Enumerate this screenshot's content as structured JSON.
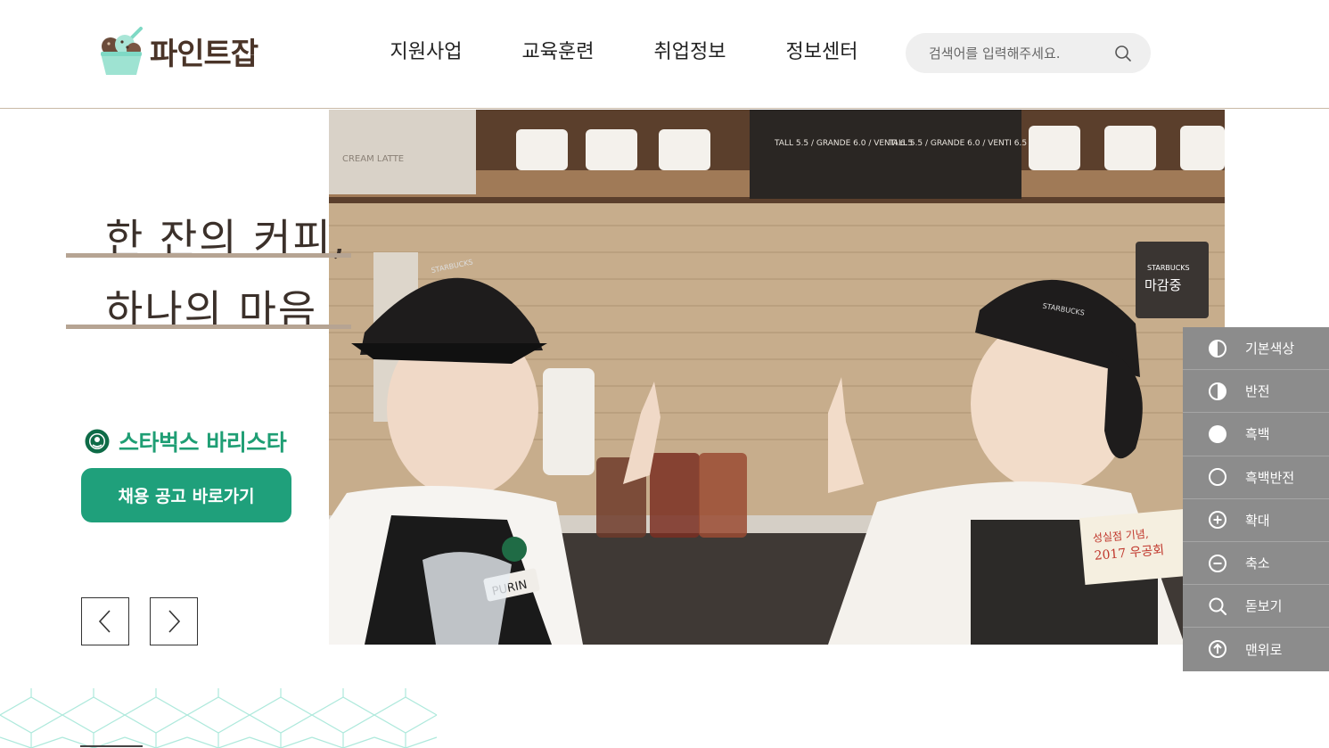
{
  "site": {
    "logo_text": "파인트잡"
  },
  "nav": {
    "items": [
      {
        "label": "지원사업"
      },
      {
        "label": "교육훈련"
      },
      {
        "label": "취업정보"
      },
      {
        "label": "정보센터"
      }
    ]
  },
  "search": {
    "placeholder": "검색어를 입력해주세요.",
    "icon": "search-icon"
  },
  "hero": {
    "slogan_line1": "한 잔의 커피,",
    "slogan_line2": "하나의 마음",
    "brand_name": "스타벅스 바리스타",
    "cta_label": "채용 공고 바로가기",
    "prev_icon": "chevron-left-icon",
    "next_icon": "chevron-right-icon"
  },
  "photo": {
    "board_text_left": "TALL 5.5 / GRANDE 6.0 / VENTI 6.5",
    "board_text_right": "TALL 5.5 / GRANDE 6.0 / VENTI 6.5",
    "closed_sign_brand": "STARBUCKS",
    "closed_sign": "마감중",
    "note_line1": "성실점 기념,",
    "note_line2": "2017 우공회",
    "name_tag": "PURIN",
    "cap_text": "STARBUCKS",
    "menu_corner": "CREAM LATTE"
  },
  "accessibility": {
    "items": [
      {
        "label": "기본색상",
        "icon": "half-circle-icon"
      },
      {
        "label": "반전",
        "icon": "contrast-icon"
      },
      {
        "label": "흑백",
        "icon": "filled-circle-icon"
      },
      {
        "label": "흑백반전",
        "icon": "empty-circle-icon"
      },
      {
        "label": "확대",
        "icon": "plus-circle-icon"
      },
      {
        "label": "축소",
        "icon": "minus-circle-icon"
      },
      {
        "label": "돋보기",
        "icon": "magnifier-icon"
      },
      {
        "label": "맨위로",
        "icon": "arrow-up-circle-icon"
      }
    ]
  },
  "colors": {
    "brand_green": "#1fa07b",
    "brown": "#4a3428",
    "accent_line": "#b6a493",
    "panel_gray": "#8c8c8c",
    "mint": "#aee9dc"
  }
}
